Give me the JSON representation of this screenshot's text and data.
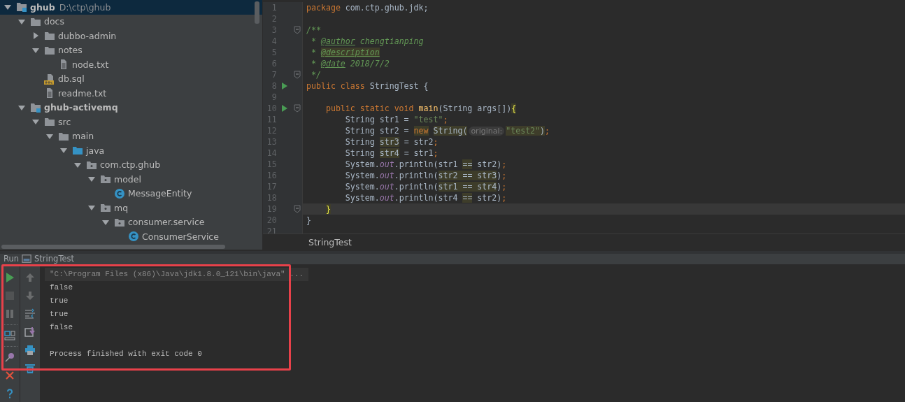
{
  "project_tree": [
    {
      "label": "ghub",
      "path": "D:\\ctp\\ghub",
      "kind": "module",
      "expanded": true,
      "selected": true,
      "children": [
        {
          "label": "docs",
          "kind": "folder",
          "expanded": true,
          "selected": false,
          "children": [
            {
              "label": "dubbo-admin",
              "kind": "folder",
              "expanded": false,
              "selected": false
            },
            {
              "label": "notes",
              "kind": "folder",
              "expanded": true,
              "selected": false,
              "children": [
                {
                  "label": "node.txt",
                  "kind": "text-file",
                  "selected": false
                }
              ]
            },
            {
              "label": "db.sql",
              "kind": "sql-file",
              "selected": false
            },
            {
              "label": "readme.txt",
              "kind": "text-file",
              "selected": false
            }
          ]
        },
        {
          "label": "ghub-activemq",
          "kind": "module",
          "expanded": true,
          "selected": false,
          "children": [
            {
              "label": "src",
              "kind": "folder",
              "expanded": true,
              "selected": false,
              "children": [
                {
                  "label": "main",
                  "kind": "folder",
                  "expanded": true,
                  "selected": false,
                  "children": [
                    {
                      "label": "java",
                      "kind": "source-folder",
                      "expanded": true,
                      "selected": false,
                      "children": [
                        {
                          "label": "com.ctp.ghub",
                          "kind": "package",
                          "expanded": true,
                          "selected": false,
                          "children": [
                            {
                              "label": "model",
                              "kind": "package",
                              "expanded": true,
                              "selected": false,
                              "children": [
                                {
                                  "label": "MessageEntity",
                                  "kind": "class",
                                  "selected": false
                                }
                              ]
                            },
                            {
                              "label": "mq",
                              "kind": "package",
                              "expanded": true,
                              "selected": false,
                              "children": [
                                {
                                  "label": "consumer.service",
                                  "kind": "package",
                                  "expanded": true,
                                  "selected": false,
                                  "children": [
                                    {
                                      "label": "ConsumerService",
                                      "kind": "class",
                                      "selected": false
                                    }
                                  ]
                                }
                              ]
                            }
                          ]
                        }
                      ]
                    }
                  ]
                }
              ]
            }
          ]
        }
      ]
    }
  ],
  "editor": {
    "lines": [
      {
        "number": "1",
        "tokens": [
          {
            "text": "package",
            "kind": "keyword"
          },
          {
            "text": " com.ctp.ghub.jdk;",
            "kind": "plain"
          }
        ]
      },
      {
        "number": "2"
      },
      {
        "number": "3",
        "fold": true,
        "tokens": [
          {
            "text": "/**",
            "kind": "comment"
          }
        ]
      },
      {
        "number": "4",
        "tokens": [
          {
            "text": " * ",
            "kind": "comment"
          },
          {
            "text": "@author",
            "kind": "doc-tag"
          },
          {
            "text": " chengtianping",
            "kind": "comment"
          }
        ]
      },
      {
        "number": "5",
        "tokens": [
          {
            "text": " * ",
            "kind": "comment"
          },
          {
            "text": "@description",
            "kind": "doc-tag",
            "highlight": true
          }
        ]
      },
      {
        "number": "6",
        "tokens": [
          {
            "text": " * ",
            "kind": "comment"
          },
          {
            "text": "@date",
            "kind": "doc-tag"
          },
          {
            "text": " 2018/7/2",
            "kind": "comment"
          }
        ]
      },
      {
        "number": "7",
        "fold": true,
        "tokens": [
          {
            "text": " */",
            "kind": "comment"
          }
        ]
      },
      {
        "number": "8",
        "run": true,
        "tokens": [
          {
            "text": "public class ",
            "kind": "keyword"
          },
          {
            "text": "StringTest {",
            "kind": "plain"
          }
        ]
      },
      {
        "number": "9"
      },
      {
        "number": "10",
        "run": true,
        "fold": true,
        "tokens": [
          {
            "text": "    public static void ",
            "kind": "keyword"
          },
          {
            "text": "main",
            "kind": "method"
          },
          {
            "text": "(String args[])",
            "kind": "plain"
          },
          {
            "text": "{",
            "kind": "brace",
            "highlight": true
          }
        ]
      },
      {
        "number": "11",
        "tokens": [
          {
            "text": "        String str1 = ",
            "kind": "plain"
          },
          {
            "text": "\"test\"",
            "kind": "string"
          },
          {
            "text": ";",
            "kind": "keyword"
          }
        ]
      },
      {
        "number": "12",
        "tokens": [
          {
            "text": "        String str2 = ",
            "kind": "plain"
          },
          {
            "text": "new",
            "kind": "keyword",
            "highlight": true
          },
          {
            "text": " String(",
            "kind": "plain",
            "highlight": true
          },
          {
            "text": "original:",
            "kind": "hint"
          },
          {
            "text": "\"test2\"",
            "kind": "string",
            "highlight": true
          },
          {
            "text": ")",
            "kind": "plain",
            "highlight": true
          },
          {
            "text": ";",
            "kind": "keyword"
          }
        ]
      },
      {
        "number": "13",
        "tokens": [
          {
            "text": "        String ",
            "kind": "plain"
          },
          {
            "text": "str3",
            "kind": "plain",
            "highlight": true
          },
          {
            "text": " = str2",
            "kind": "plain"
          },
          {
            "text": ";",
            "kind": "keyword"
          }
        ]
      },
      {
        "number": "14",
        "tokens": [
          {
            "text": "        String ",
            "kind": "plain"
          },
          {
            "text": "str4",
            "kind": "plain",
            "highlight": true
          },
          {
            "text": " = str1",
            "kind": "plain"
          },
          {
            "text": ";",
            "kind": "keyword"
          }
        ]
      },
      {
        "number": "15",
        "tokens": [
          {
            "text": "        System.",
            "kind": "plain"
          },
          {
            "text": "out",
            "kind": "field"
          },
          {
            "text": ".println(str1 ",
            "kind": "plain"
          },
          {
            "text": "==",
            "kind": "plain",
            "highlight": true
          },
          {
            "text": " str2)",
            "kind": "plain"
          },
          {
            "text": ";",
            "kind": "keyword"
          }
        ]
      },
      {
        "number": "16",
        "tokens": [
          {
            "text": "        System.",
            "kind": "plain"
          },
          {
            "text": "out",
            "kind": "field"
          },
          {
            "text": ".println(",
            "kind": "plain"
          },
          {
            "text": "str2 == str3",
            "kind": "plain",
            "highlight": true
          },
          {
            "text": ")",
            "kind": "plain"
          },
          {
            "text": ";",
            "kind": "keyword"
          }
        ]
      },
      {
        "number": "17",
        "tokens": [
          {
            "text": "        System.",
            "kind": "plain"
          },
          {
            "text": "out",
            "kind": "field"
          },
          {
            "text": ".println(",
            "kind": "plain"
          },
          {
            "text": "str1 == str4",
            "kind": "plain",
            "highlight": true
          },
          {
            "text": ")",
            "kind": "plain"
          },
          {
            "text": ";",
            "kind": "keyword"
          }
        ]
      },
      {
        "number": "18",
        "tokens": [
          {
            "text": "        System.",
            "kind": "plain"
          },
          {
            "text": "out",
            "kind": "field"
          },
          {
            "text": ".println(str4 ",
            "kind": "plain"
          },
          {
            "text": "==",
            "kind": "plain",
            "highlight": true
          },
          {
            "text": " str2)",
            "kind": "plain"
          },
          {
            "text": ";",
            "kind": "keyword"
          }
        ]
      },
      {
        "number": "19",
        "fold": true,
        "current": true,
        "tokens": [
          {
            "text": "    }",
            "kind": "brace",
            "highlight": true
          }
        ]
      },
      {
        "number": "20",
        "tokens": [
          {
            "text": "}",
            "kind": "plain"
          }
        ]
      },
      {
        "number": "21"
      }
    ],
    "breadcrumb": "StringTest"
  },
  "run_panel": {
    "title": "Run",
    "config": "StringTest",
    "highlight_frame": true,
    "left_tools": [
      {
        "kind": "run",
        "enabled": true
      },
      {
        "kind": "stop",
        "enabled": false
      },
      {
        "kind": "pause",
        "enabled": false
      },
      {
        "kind": "separator"
      },
      {
        "kind": "layout",
        "enabled": true
      },
      {
        "kind": "separator"
      },
      {
        "kind": "pin",
        "enabled": true
      },
      {
        "kind": "close",
        "enabled": true
      },
      {
        "kind": "help",
        "enabled": true
      }
    ],
    "right_tools": [
      {
        "kind": "up",
        "enabled": false
      },
      {
        "kind": "down",
        "enabled": false
      },
      {
        "kind": "wrap",
        "enabled": true
      },
      {
        "kind": "scroll-end",
        "enabled": true
      },
      {
        "kind": "print",
        "enabled": true
      },
      {
        "kind": "clear",
        "enabled": true
      }
    ],
    "console": [
      {
        "text": "\"C:\\Program Files (x86)\\Java\\jdk1.8.0_121\\bin\\java\" ...",
        "kind": "command"
      },
      {
        "text": "false",
        "kind": "output"
      },
      {
        "text": "true",
        "kind": "output"
      },
      {
        "text": "true",
        "kind": "output"
      },
      {
        "text": "false",
        "kind": "output"
      },
      {
        "kind": "blank"
      },
      {
        "text": "Process finished with exit code 0",
        "kind": "output"
      }
    ]
  }
}
